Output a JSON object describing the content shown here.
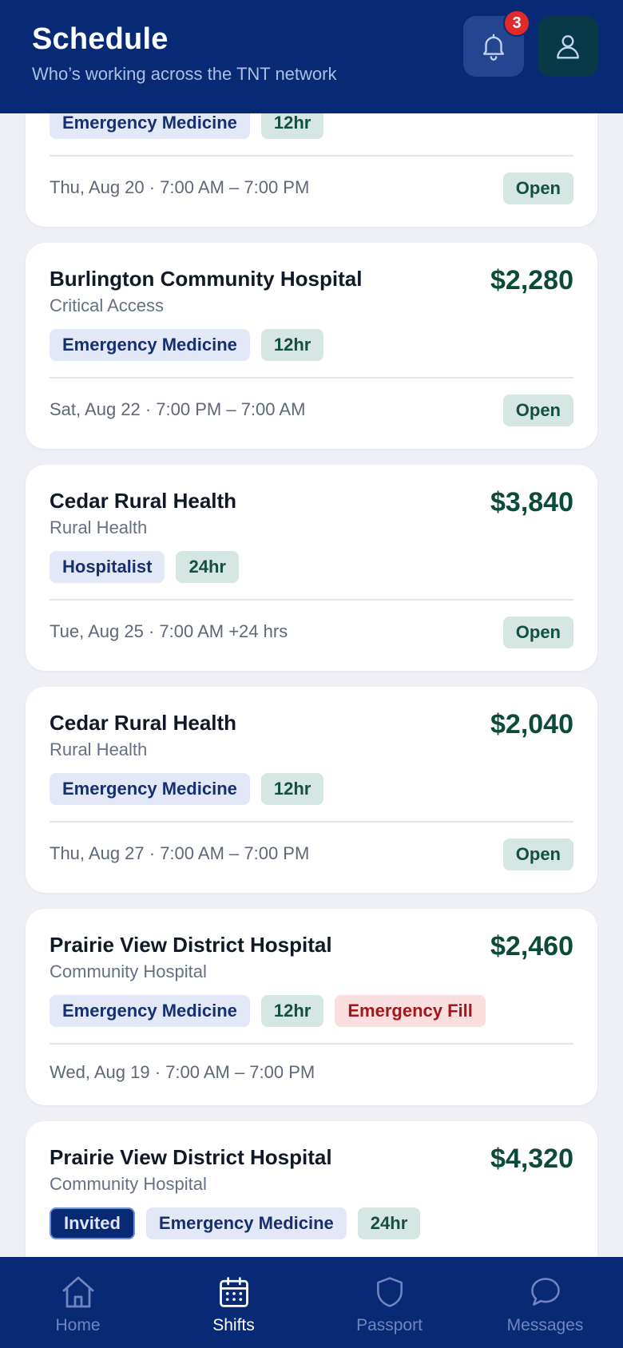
{
  "header": {
    "title": "Schedule",
    "subtitle": "Who’s working across the TNT network",
    "notification_count": "3"
  },
  "shifts": [
    {
      "specialty": "Emergency Medicine",
      "length": "12hr",
      "datetime": "Thu, Aug 20 · 7:00 AM – 7:00 PM",
      "status": "Open"
    },
    {
      "facility": "Burlington Community Hospital",
      "facility_type": "Critical Access",
      "rate": "$2,280",
      "specialty": "Emergency Medicine",
      "length": "12hr",
      "datetime": "Sat, Aug 22 · 7:00 PM – 7:00 AM",
      "status": "Open"
    },
    {
      "facility": "Cedar Rural Health",
      "facility_type": "Rural Health",
      "rate": "$3,840",
      "specialty": "Hospitalist",
      "length": "24hr",
      "datetime": "Tue, Aug 25 · 7:00 AM +24 hrs",
      "status": "Open"
    },
    {
      "facility": "Cedar Rural Health",
      "facility_type": "Rural Health",
      "rate": "$2,040",
      "specialty": "Emergency Medicine",
      "length": "12hr",
      "datetime": "Thu, Aug 27 · 7:00 AM – 7:00 PM",
      "status": "Open"
    },
    {
      "facility": "Prairie View District Hospital",
      "facility_type": "Community Hospital",
      "rate": "$2,460",
      "specialty": "Emergency Medicine",
      "length": "12hr",
      "flag": "Emergency Fill",
      "datetime": "Wed, Aug 19 · 7:00 AM – 7:00 PM"
    },
    {
      "facility": "Prairie View District Hospital",
      "facility_type": "Community Hospital",
      "rate": "$4,320",
      "invite": "Invited",
      "specialty": "Emergency Medicine",
      "length": "24hr"
    }
  ],
  "nav": {
    "items": [
      {
        "label": "Home",
        "icon": "home-icon"
      },
      {
        "label": "Shifts",
        "icon": "calendar-icon",
        "active": true
      },
      {
        "label": "Passport",
        "icon": "shield-icon"
      },
      {
        "label": "Messages",
        "icon": "chat-icon"
      }
    ]
  },
  "colors": {
    "brand_navy": "#082a74",
    "rate_green": "#0c4a3a",
    "open_bg": "#d6e6e2",
    "emergency_bg": "#fbdede",
    "emergency_text": "#a3161b",
    "notification_red": "#e32a2a"
  }
}
